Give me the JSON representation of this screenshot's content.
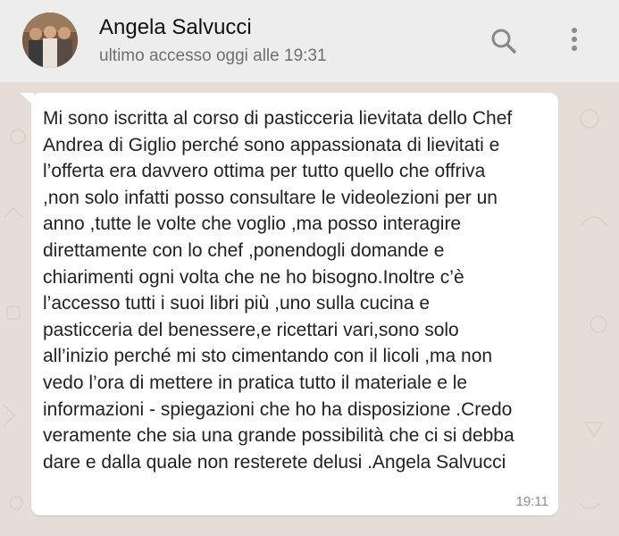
{
  "header": {
    "contact_name": "Angela Salvucci",
    "last_seen": "ultimo accesso oggi alle 19:31",
    "avatar_icon": "profile-photo",
    "search_icon": "search-icon",
    "menu_icon": "more-vert-icon"
  },
  "message": {
    "text": "Mi sono iscritta al corso di pasticceria lievitata dello Chef\nAndrea di Giglio perché sono appassionata di lievitati e\nl’offerta era davvero ottima per tutto quello che offriva\n,non solo infatti posso consultare le videolezioni per un\nanno ,tutte le volte che voglio ,ma posso interagire\ndirettamente con lo chef ,ponendogli domande e\nchiarimenti ogni volta che ne ho bisogno.Inoltre c’è\nl’accesso  tutti i suoi libri più ,uno sulla cucina e\npasticceria del benessere,e ricettari vari,sono solo\nall’inizio perché mi sto cimentando con il licoli ,ma non\nvedo l’ora di mettere in pratica tutto il materiale e le\ninformazioni - spiegazioni che ho ha disposizione .Credo\nveramente che sia una grande possibilità che ci si debba\ndare e dalla quale non resterete delusi .Angela Salvucci",
    "time": "19:11"
  },
  "colors": {
    "header_bg": "#ededed",
    "chat_bg": "#e6ded6",
    "bubble_bg": "#ffffff",
    "icon_gray": "#8a8a8a"
  }
}
